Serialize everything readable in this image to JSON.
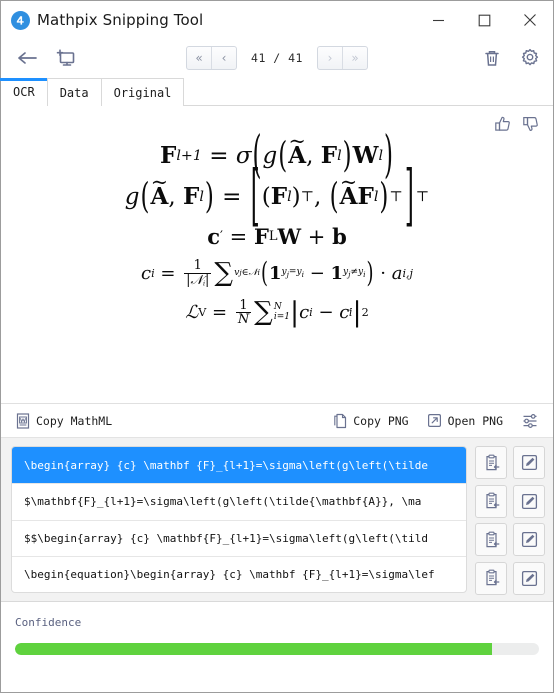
{
  "window": {
    "title": "Mathpix Snipping Tool",
    "logo_icon": "mathpix-logo-icon",
    "controls": {
      "minimize": "minimize-icon",
      "maximize": "maximize-icon",
      "close": "close-icon"
    }
  },
  "toolbar": {
    "back_icon": "back-arrow-icon",
    "new_snip_icon": "new-snip-icon",
    "first_page": "«",
    "prev_page": "‹",
    "page_indicator": "41 / 41",
    "next_page": "›",
    "last_page": "»",
    "delete_icon": "trash-icon",
    "settings_icon": "gear-icon"
  },
  "tabs": [
    {
      "label": "OCR",
      "active": true
    },
    {
      "label": "Data",
      "active": false
    },
    {
      "label": "Original",
      "active": false
    }
  ],
  "preview": {
    "thumbs_up_icon": "thumbs-up-icon",
    "thumbs_down_icon": "thumbs-down-icon",
    "equations": [
      "F_{l+1} = σ( g( Ã, F_l ) W_l )",
      "g( Ã, F_l ) = [ (F_l)^⊤ , ( Ã F_l )^⊤ ]^⊤",
      "c' = F_L W + b",
      "c_i = (1/|N_i|) ∑_{v_j ∈ N_i} ( 1_{y_j=y_i} − 1_{y_j≠y_i} ) · a_{i,j}",
      "L_V = (1/N) ∑_{i=1}^{N} | c_i − c'_i |^2"
    ]
  },
  "copybar": {
    "copy_mathml": "Copy MathML",
    "copy_mathml_icon": "word-doc-icon",
    "copy_png": "Copy PNG",
    "copy_png_icon": "copy-page-icon",
    "open_png": "Open PNG",
    "open_png_icon": "external-link-icon",
    "options_icon": "sliders-icon"
  },
  "results": {
    "rows": [
      {
        "text": "\\begin{array} {c}  \\mathbf {F}_{l+1}=\\sigma\\left(g\\left(\\tilde",
        "selected": true
      },
      {
        "text": "$\\mathbf{F}_{l+1}=\\sigma\\left(g\\left(\\tilde{\\mathbf{A}}, \\ma",
        "selected": false
      },
      {
        "text": "$$\\begin{array} {c}  \\mathbf{F}_{l+1}=\\sigma\\left(g\\left(\\tild",
        "selected": false
      },
      {
        "text": "\\begin{equation}\\begin{array} {c}  \\mathbf {F}_{l+1}=\\sigma\\lef",
        "selected": false
      }
    ],
    "copy_icon": "clipboard-copy-icon",
    "edit_icon": "edit-square-icon"
  },
  "confidence": {
    "label": "Confidence",
    "percent": 91,
    "fill_color": "#5fd23e",
    "track_color": "#eceded"
  },
  "colors": {
    "accent": "#1e90ff",
    "icon": "#6a7290",
    "logo": "#2f8fe0"
  }
}
